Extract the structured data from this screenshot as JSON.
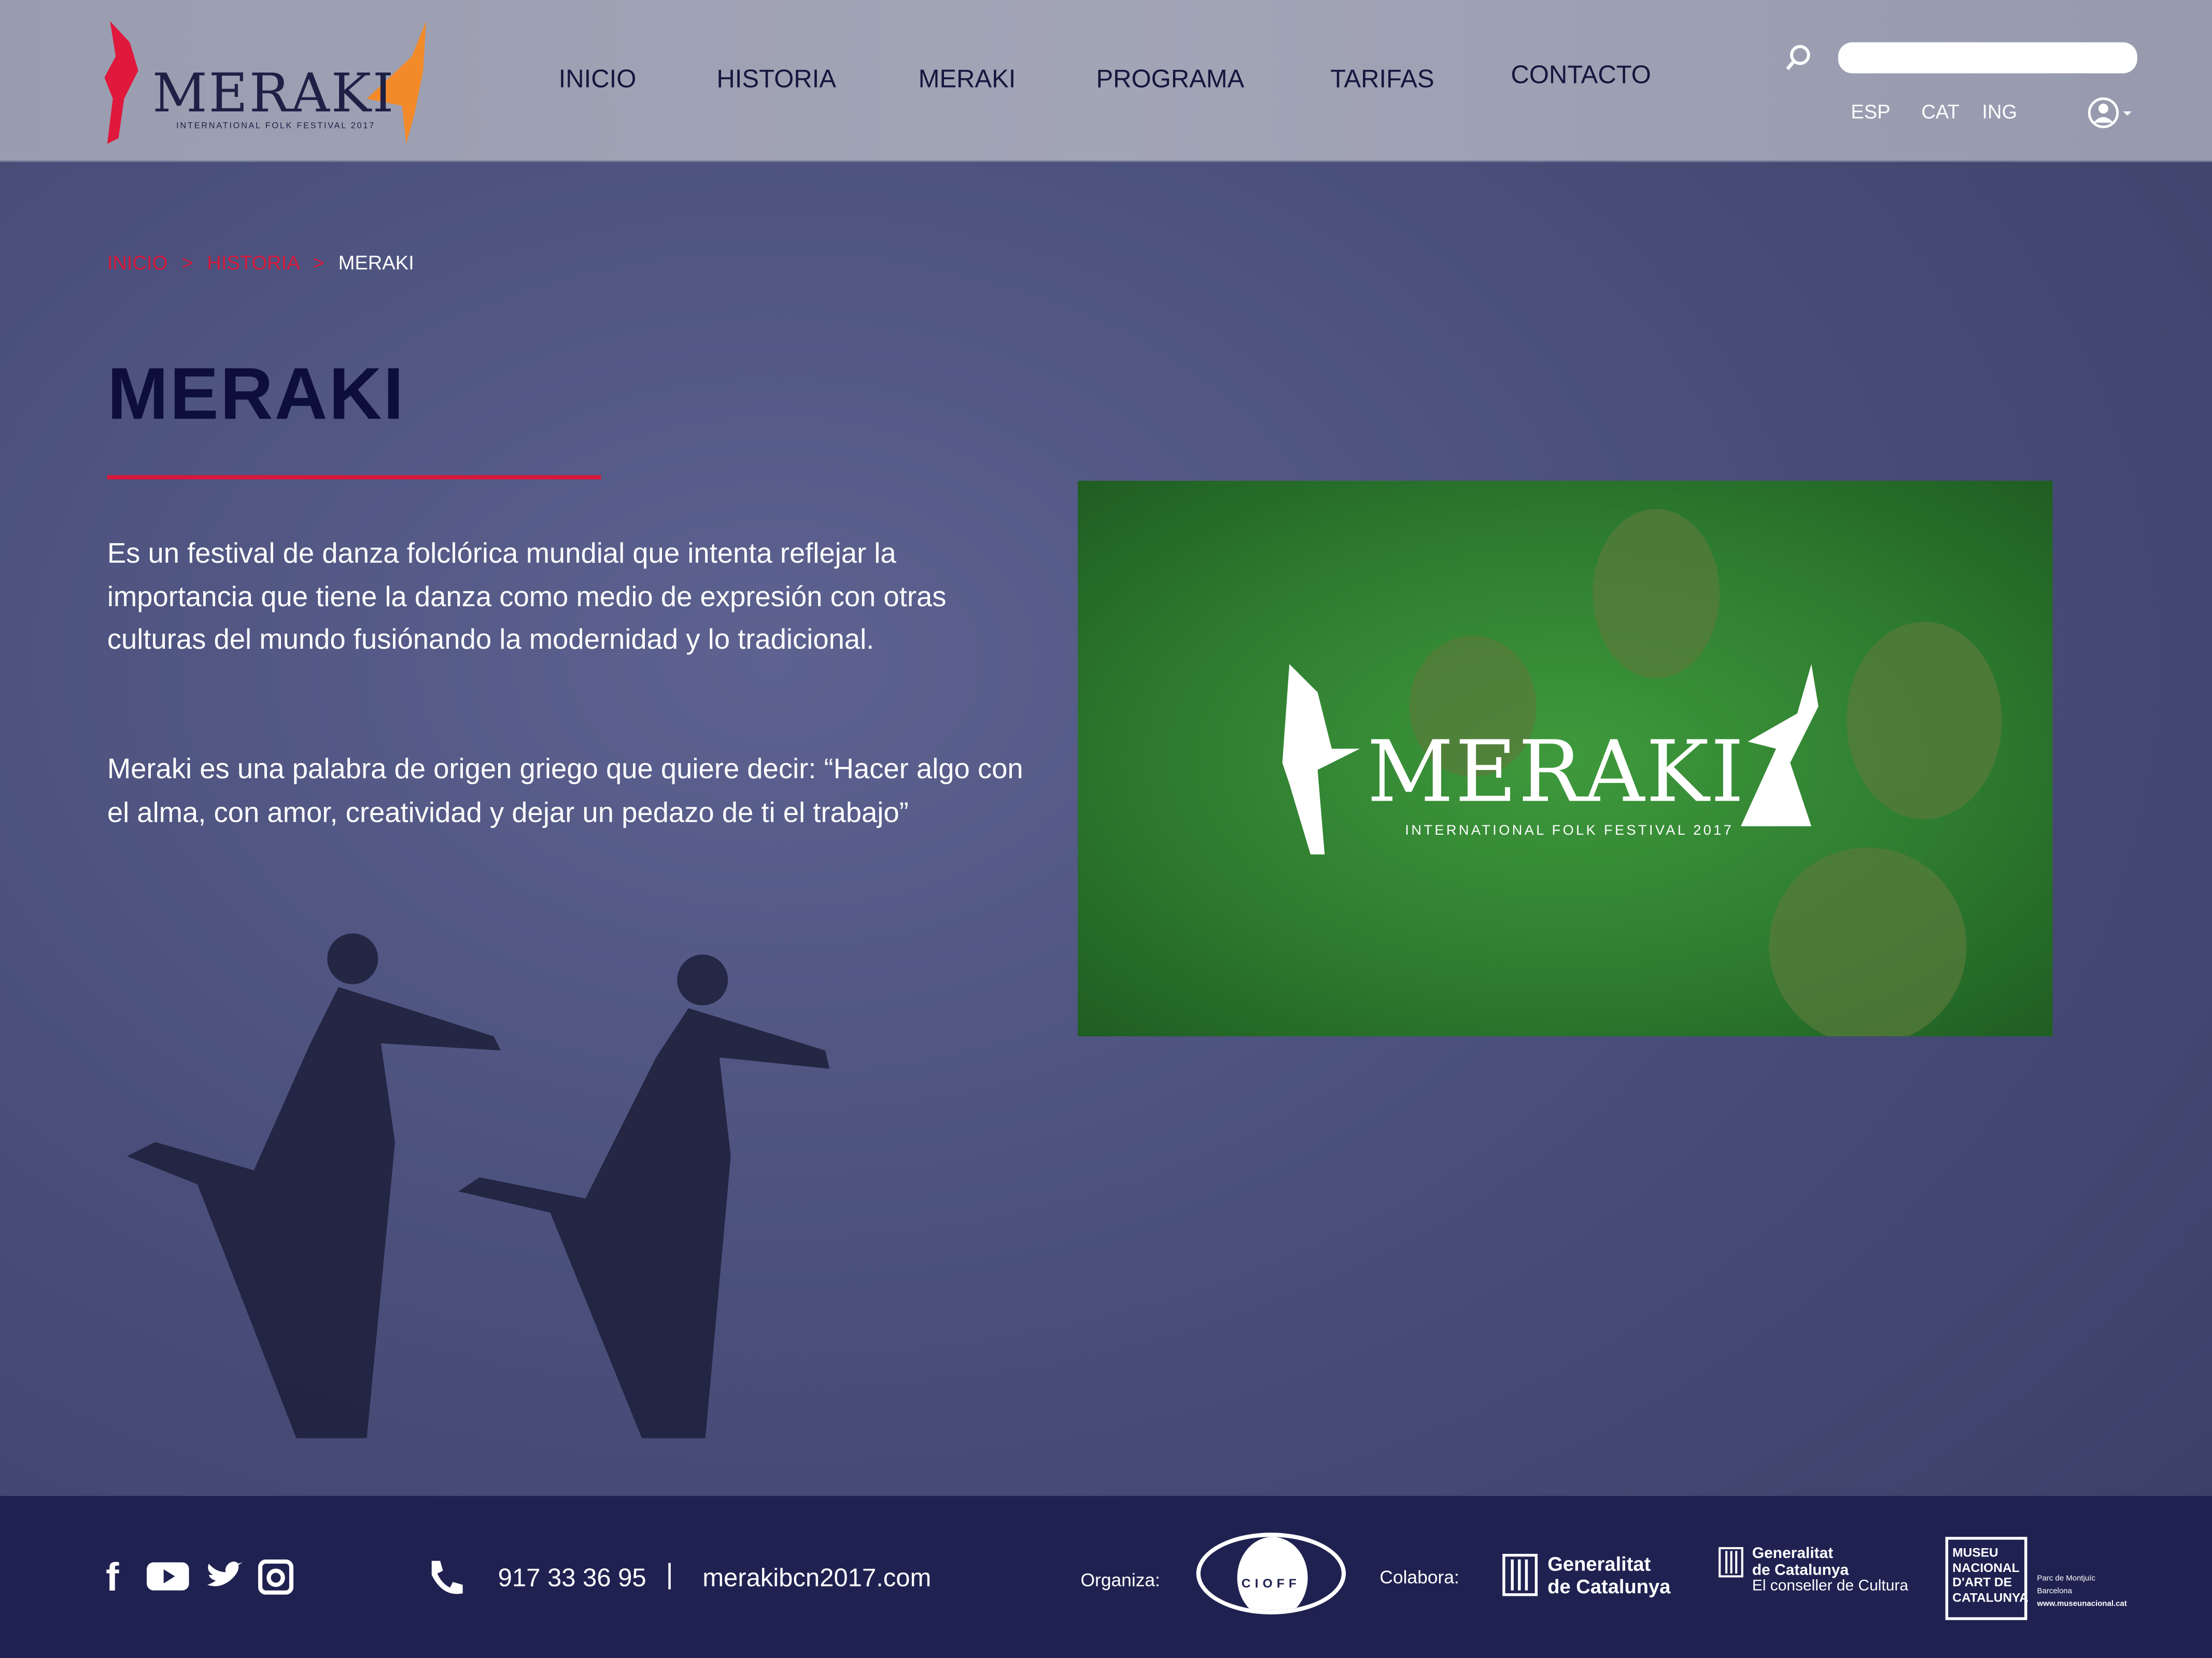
{
  "header": {
    "logo": {
      "word": "MERAKI",
      "subtitle": "INTERNATIONAL FOLK FESTIVAL 2017",
      "colors": {
        "left_dancer": "#e0183c",
        "right_dancer": "#f28a2a"
      }
    },
    "nav": [
      {
        "label": "INICIO"
      },
      {
        "label": "HISTORIA"
      },
      {
        "label": "MERAKI"
      },
      {
        "label": "PROGRAMA"
      },
      {
        "label": "TARIFAS"
      },
      {
        "label": "CONTACTO"
      }
    ],
    "search": {
      "icon": "search-icon",
      "value": "",
      "placeholder": ""
    },
    "languages": [
      {
        "label": "ESP"
      },
      {
        "label": "CAT"
      },
      {
        "label": "ING"
      }
    ],
    "user_icon": "user-icon"
  },
  "breadcrumb": [
    {
      "label": "INICIO"
    },
    {
      "sep": ">"
    },
    {
      "label": "HISTORIA"
    },
    {
      "sep": ">"
    },
    {
      "label": "MERAKI"
    }
  ],
  "main": {
    "title": "MERAKI",
    "paragraph1": "Es un festival de danza folclórica mundial que intenta reflejar la importancia que tiene la danza como medio de expresión con otras culturas del mundo fusiónando la modernidad y lo tradicional.",
    "paragraph2": "Meraki es una palabra de origen griego que quiere decir: “Hacer algo con el alma, con amor, creatividad y dejar un pedazo de ti el trabajo”",
    "photo": {
      "word": "MERAKI",
      "subtitle": "INTERNATIONAL FOLK FESTIVAL 2017"
    }
  },
  "footer": {
    "social": [
      "facebook-icon",
      "youtube-icon",
      "twitter-icon",
      "instagram-icon"
    ],
    "phone": "917 33 36 95",
    "separator": "|",
    "website": "merakibcn2017.com",
    "organiza_label": "Organiza:",
    "cioff": "CIOFF",
    "colabora_label": "Colabora:",
    "sponsor1": {
      "line1": "Generalitat",
      "line2": "de Catalunya"
    },
    "sponsor2": {
      "line1": "Generalitat",
      "line2": "de Catalunya",
      "line3": "El conseller de Cultura"
    },
    "museum": {
      "name_lines": [
        "MUSEU",
        "NACIONAL",
        "D'ART DE",
        "CATALUNYA"
      ],
      "info_lines": [
        "Parc de Montjuïc",
        "Barcelona",
        "www.museunacional.cat"
      ]
    }
  },
  "colors": {
    "accent": "#d7183a",
    "title": "#0d0e3a",
    "footer_bg": "#1f2250"
  }
}
